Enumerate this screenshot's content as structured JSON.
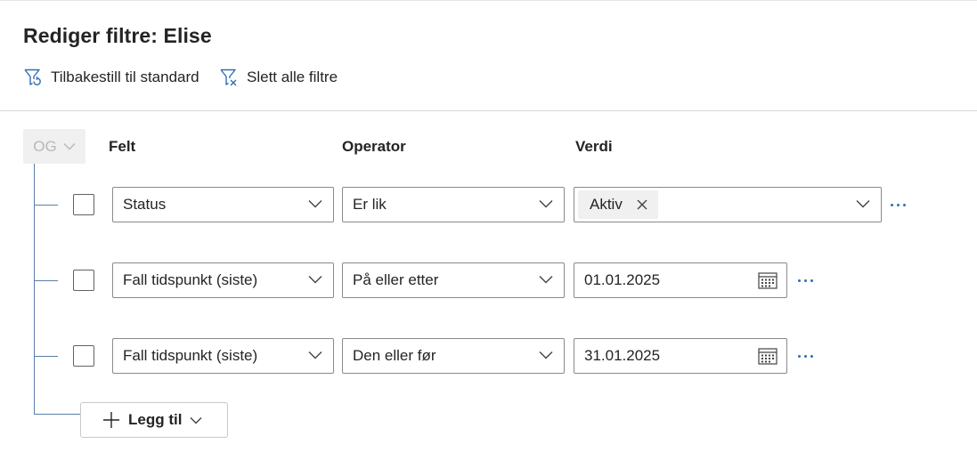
{
  "header": {
    "title": "Rediger filtre: Elise"
  },
  "commands": {
    "reset_label": "Tilbakestill til standard",
    "reset_icon": "filter-reset-icon",
    "clear_label": "Slett alle filtre",
    "clear_icon": "filter-clear-icon"
  },
  "group": {
    "operator": "OG"
  },
  "columns": {
    "field": "Felt",
    "operator": "Operator",
    "value": "Verdi"
  },
  "rows": [
    {
      "field": "Status",
      "operator": "Er lik",
      "value": "Aktiv",
      "value_type": "multi-select"
    },
    {
      "field": "Fall tidspunkt (siste)",
      "operator": "På eller etter",
      "value": "01.01.2025",
      "value_type": "date"
    },
    {
      "field": "Fall tidspunkt (siste)",
      "operator": "Den eller før",
      "value": "31.01.2025",
      "value_type": "date"
    }
  ],
  "add": {
    "label": "Legg til"
  },
  "colors": {
    "accent": "#2f6fb5",
    "tree_line": "#5a7ea8",
    "border": "#8a8a8a",
    "text": "#242424"
  }
}
